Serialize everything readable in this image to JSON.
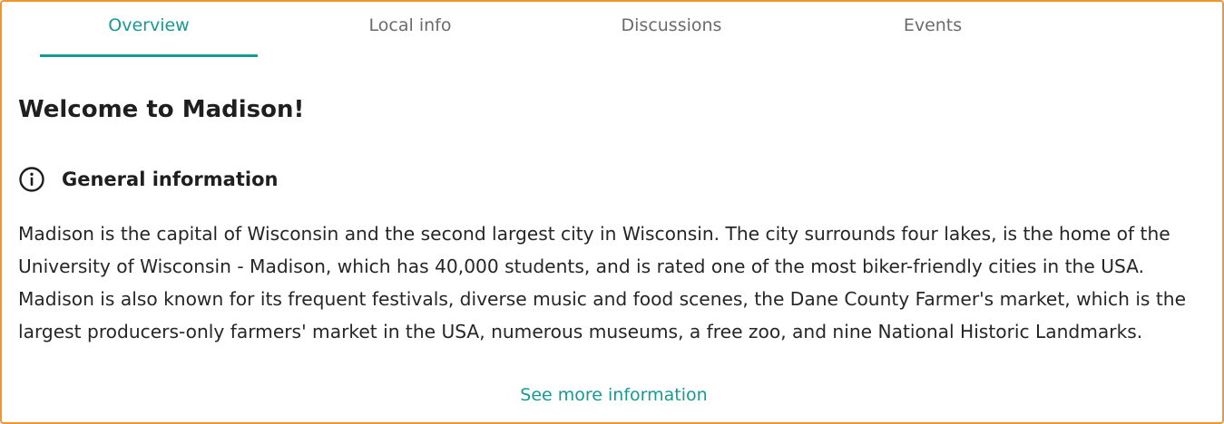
{
  "tabs": [
    {
      "label": "Overview",
      "active": true
    },
    {
      "label": "Local info",
      "active": false
    },
    {
      "label": "Discussions",
      "active": false
    },
    {
      "label": "Events",
      "active": false
    }
  ],
  "page": {
    "title": "Welcome to Madison!"
  },
  "general_info": {
    "icon": "info-circle-icon",
    "heading": "General information",
    "body": "Madison is the capital of Wisconsin and the second largest city in Wisconsin. The city surrounds four lakes, is the home of the University of Wisconsin - Madison, which has 40,000 students, and is rated one of the most biker-friendly cities in the USA. Madison is also known for its frequent festivals, diverse music and food scenes, the Dane County Farmer's market, which is the largest producers-only farmers' market in the USA, numerous museums, a free zoo, and nine National Historic Landmarks.",
    "see_more": "See more information"
  },
  "colors": {
    "accent": "#169a92",
    "frame_border": "#f0962e",
    "tab_inactive": "#6b6b6b",
    "text": "#262626"
  }
}
